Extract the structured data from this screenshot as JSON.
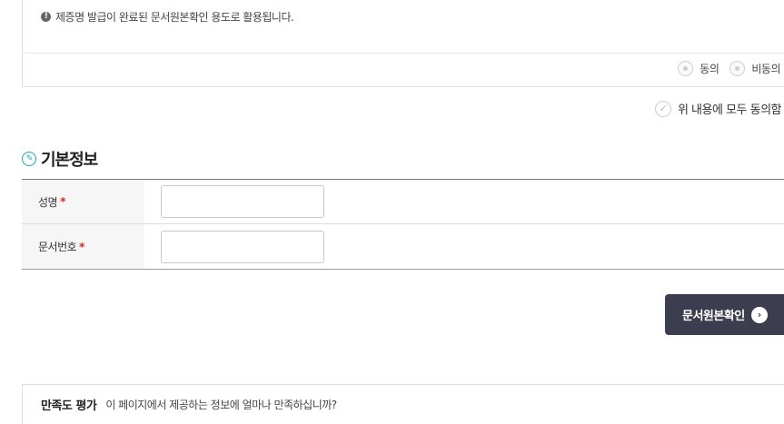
{
  "notice": {
    "text": "제증명 발급이 완료된 문서원본확인 용도로 활용됩니다.",
    "icon": "info-icon"
  },
  "consent": {
    "agree_label": "동의",
    "disagree_label": "비동의"
  },
  "all_agree_label": "위 내용에 모두 동의함",
  "section": {
    "title": "기본정보",
    "icon": "edit-icon"
  },
  "form": {
    "name_label": "성명",
    "doc_number_label": "문서번호",
    "required_mark": "*",
    "name_value": "",
    "doc_number_value": ""
  },
  "confirm_button_label": "문서원본확인",
  "survey": {
    "title": "만족도 평가",
    "question": "이 페이지에서 제공하는 정보에 얼마나 만족하십니까?"
  },
  "colors": {
    "button_bg": "#3c3d4e",
    "accent": "#1ba3c7",
    "required": "#dd2222"
  }
}
